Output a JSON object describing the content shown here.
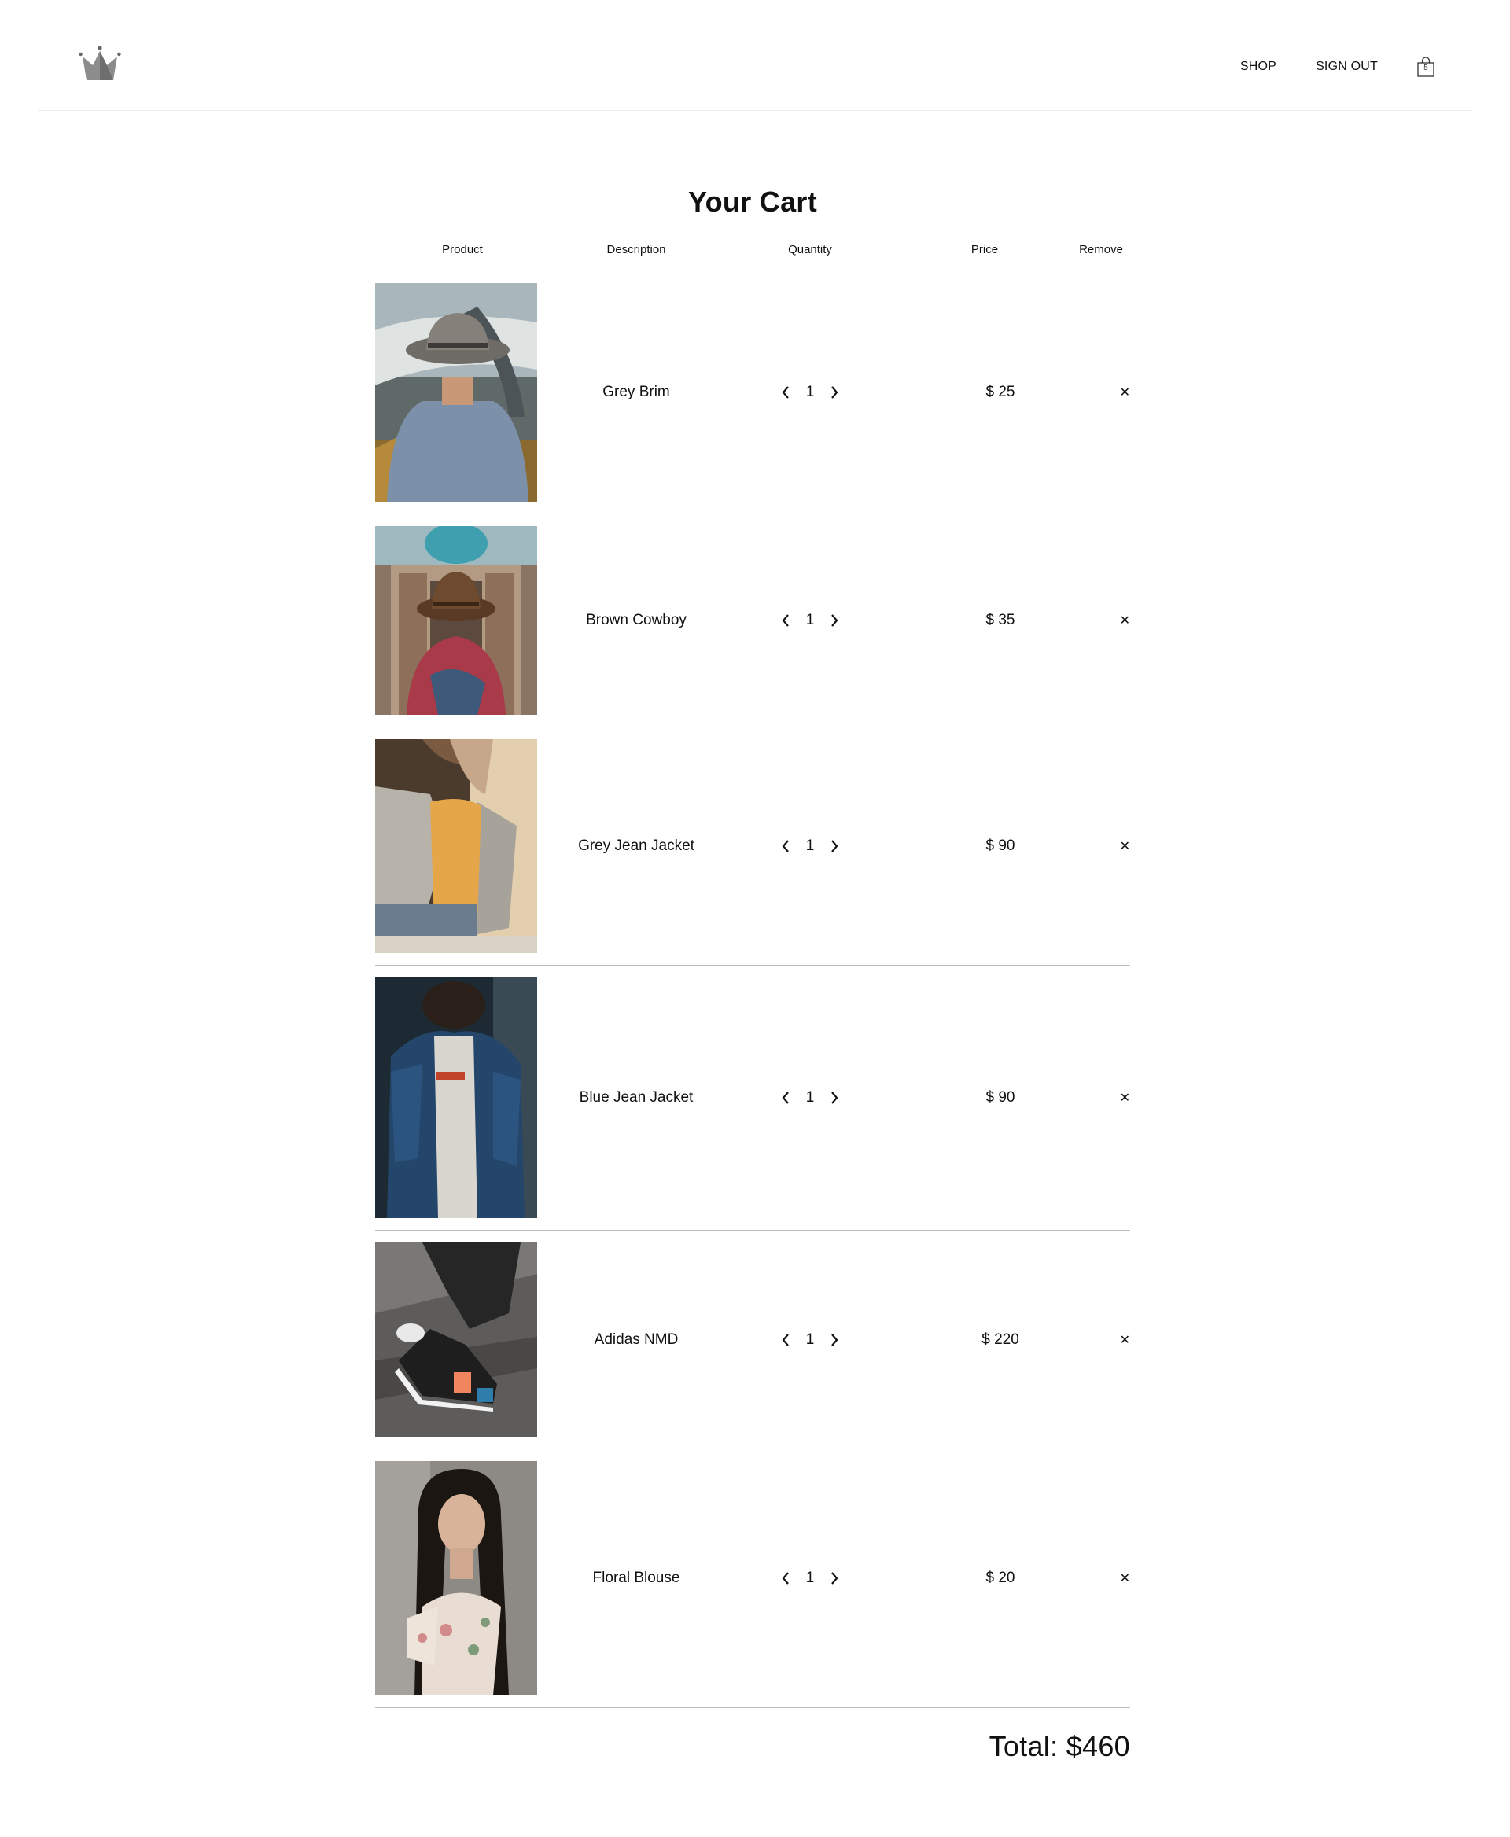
{
  "nav": {
    "shop_label": "SHOP",
    "signout_label": "SIGN OUT",
    "cart_count": "5"
  },
  "cart": {
    "title": "Your Cart",
    "columns": {
      "product": "Product",
      "description": "Description",
      "quantity": "Quantity",
      "price": "Price",
      "remove": "Remove"
    },
    "items": [
      {
        "name": "Grey Brim",
        "quantity": "1",
        "price": "$ 25",
        "remove_icon": "✕",
        "photo": "man-grey-hat-coastal-road"
      },
      {
        "name": "Brown Cowboy",
        "quantity": "1",
        "price": "$ 35",
        "remove_icon": "✕",
        "photo": "person-brown-hat-red-scarf-mosque"
      },
      {
        "name": "Grey Jean Jacket",
        "quantity": "1",
        "price": "$ 90",
        "remove_icon": "✕",
        "photo": "woman-grey-denim-jacket-orange-top"
      },
      {
        "name": "Blue Jean Jacket",
        "quantity": "1",
        "price": "$ 90",
        "remove_icon": "✕",
        "photo": "man-blue-denim-jacket"
      },
      {
        "name": "Adidas NMD",
        "quantity": "1",
        "price": "$ 220",
        "remove_icon": "✕",
        "photo": "black-sneaker-on-wood"
      },
      {
        "name": "Floral Blouse",
        "quantity": "1",
        "price": "$ 20",
        "remove_icon": "✕",
        "photo": "woman-floral-blouse"
      }
    ],
    "total": "Total: $460"
  },
  "colors": {
    "text": "#111111",
    "divider": "#bdbdbd",
    "logo": "#808080"
  }
}
